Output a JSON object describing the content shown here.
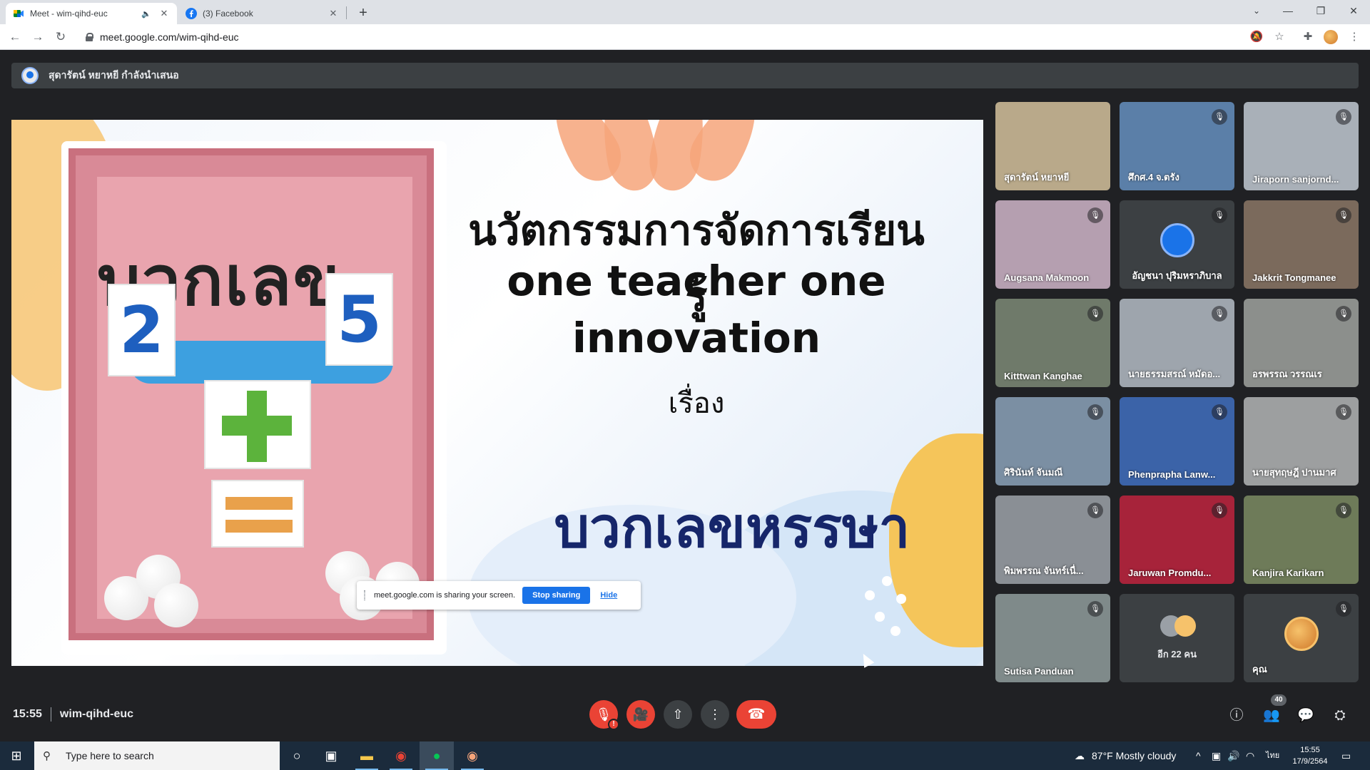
{
  "browser": {
    "tabs": [
      {
        "title": "Meet - wim-qihd-euc",
        "icon": "google-meet-icon",
        "audio": true
      },
      {
        "title": "(3) Facebook",
        "icon": "facebook-icon"
      }
    ],
    "url": "meet.google.com/wim-qihd-euc"
  },
  "meet": {
    "presenter_text": "สุดารัตน์ หยาหยี กำลังนำเสนอ",
    "slide": {
      "line1": "นวัตกรรมการจัดการเรียนรู้",
      "line2": "one teacher one",
      "line3": "innovation",
      "line4": "เรื่อง",
      "line5": "บวกเลขหรรษา",
      "box_title": "บวกเลข",
      "card_left": "2",
      "card_right": "5"
    },
    "share_notice": {
      "text": "meet.google.com is sharing your screen.",
      "stop_label": "Stop sharing",
      "hide_label": "Hide"
    },
    "participants": [
      {
        "name": "สุดารัตน์ หยาหยี",
        "muted": false,
        "bg": "#b9a98a"
      },
      {
        "name": "ศึกศ.4 จ.ตรัง",
        "muted": true,
        "bg": "#5b7fa8"
      },
      {
        "name": "Jiraporn sanjornd...",
        "muted": true,
        "bg": "#a9b0b8"
      },
      {
        "name": "Augsana Makmoon",
        "muted": true,
        "bg": "#b59fb0"
      },
      {
        "name": "อัญชนา ปุริมหราภิบาล",
        "muted": true,
        "bg": "#3c4043",
        "avatar": true
      },
      {
        "name": "Jakkrit Tongmanee",
        "muted": true,
        "bg": "#7b6a5c"
      },
      {
        "name": "Kitttwan Kanghae",
        "muted": true,
        "bg": "#6f7a6a"
      },
      {
        "name": "นายธรรมสรณ์ หมัดอ...",
        "muted": true,
        "bg": "#9ea5ad"
      },
      {
        "name": "อรพรรณ วรรณเร",
        "muted": true,
        "bg": "#8c8f8c"
      },
      {
        "name": "ศิรินันท์ จันมณี",
        "muted": true,
        "bg": "#7b8fa3"
      },
      {
        "name": "Phenprapha Lanw...",
        "muted": true,
        "bg": "#3b63a8"
      },
      {
        "name": "นายสุทฤษฎี ปานมาศ",
        "muted": true,
        "bg": "#9d9fa0"
      },
      {
        "name": "พิมพรรณ จันทร์เนื่...",
        "muted": true,
        "bg": "#8a8f95"
      },
      {
        "name": "Jaruwan Promdu...",
        "muted": true,
        "bg": "#a7233a"
      },
      {
        "name": "Kanjira Karikarn",
        "muted": true,
        "bg": "#6e7b59"
      },
      {
        "name": "Sutisa Panduan",
        "muted": true,
        "bg": "#7f8a8a"
      }
    ],
    "more_label": "อีก 22 คน",
    "self_label": "คุณ",
    "time": "15:55",
    "meeting_code": "wim-qihd-euc",
    "people_count": "40"
  },
  "taskbar": {
    "search_placeholder": "Type here to search",
    "weather": "87°F  Mostly cloudy",
    "lang": "ไทย",
    "clock_time": "15:55",
    "clock_date": "17/9/2564"
  }
}
